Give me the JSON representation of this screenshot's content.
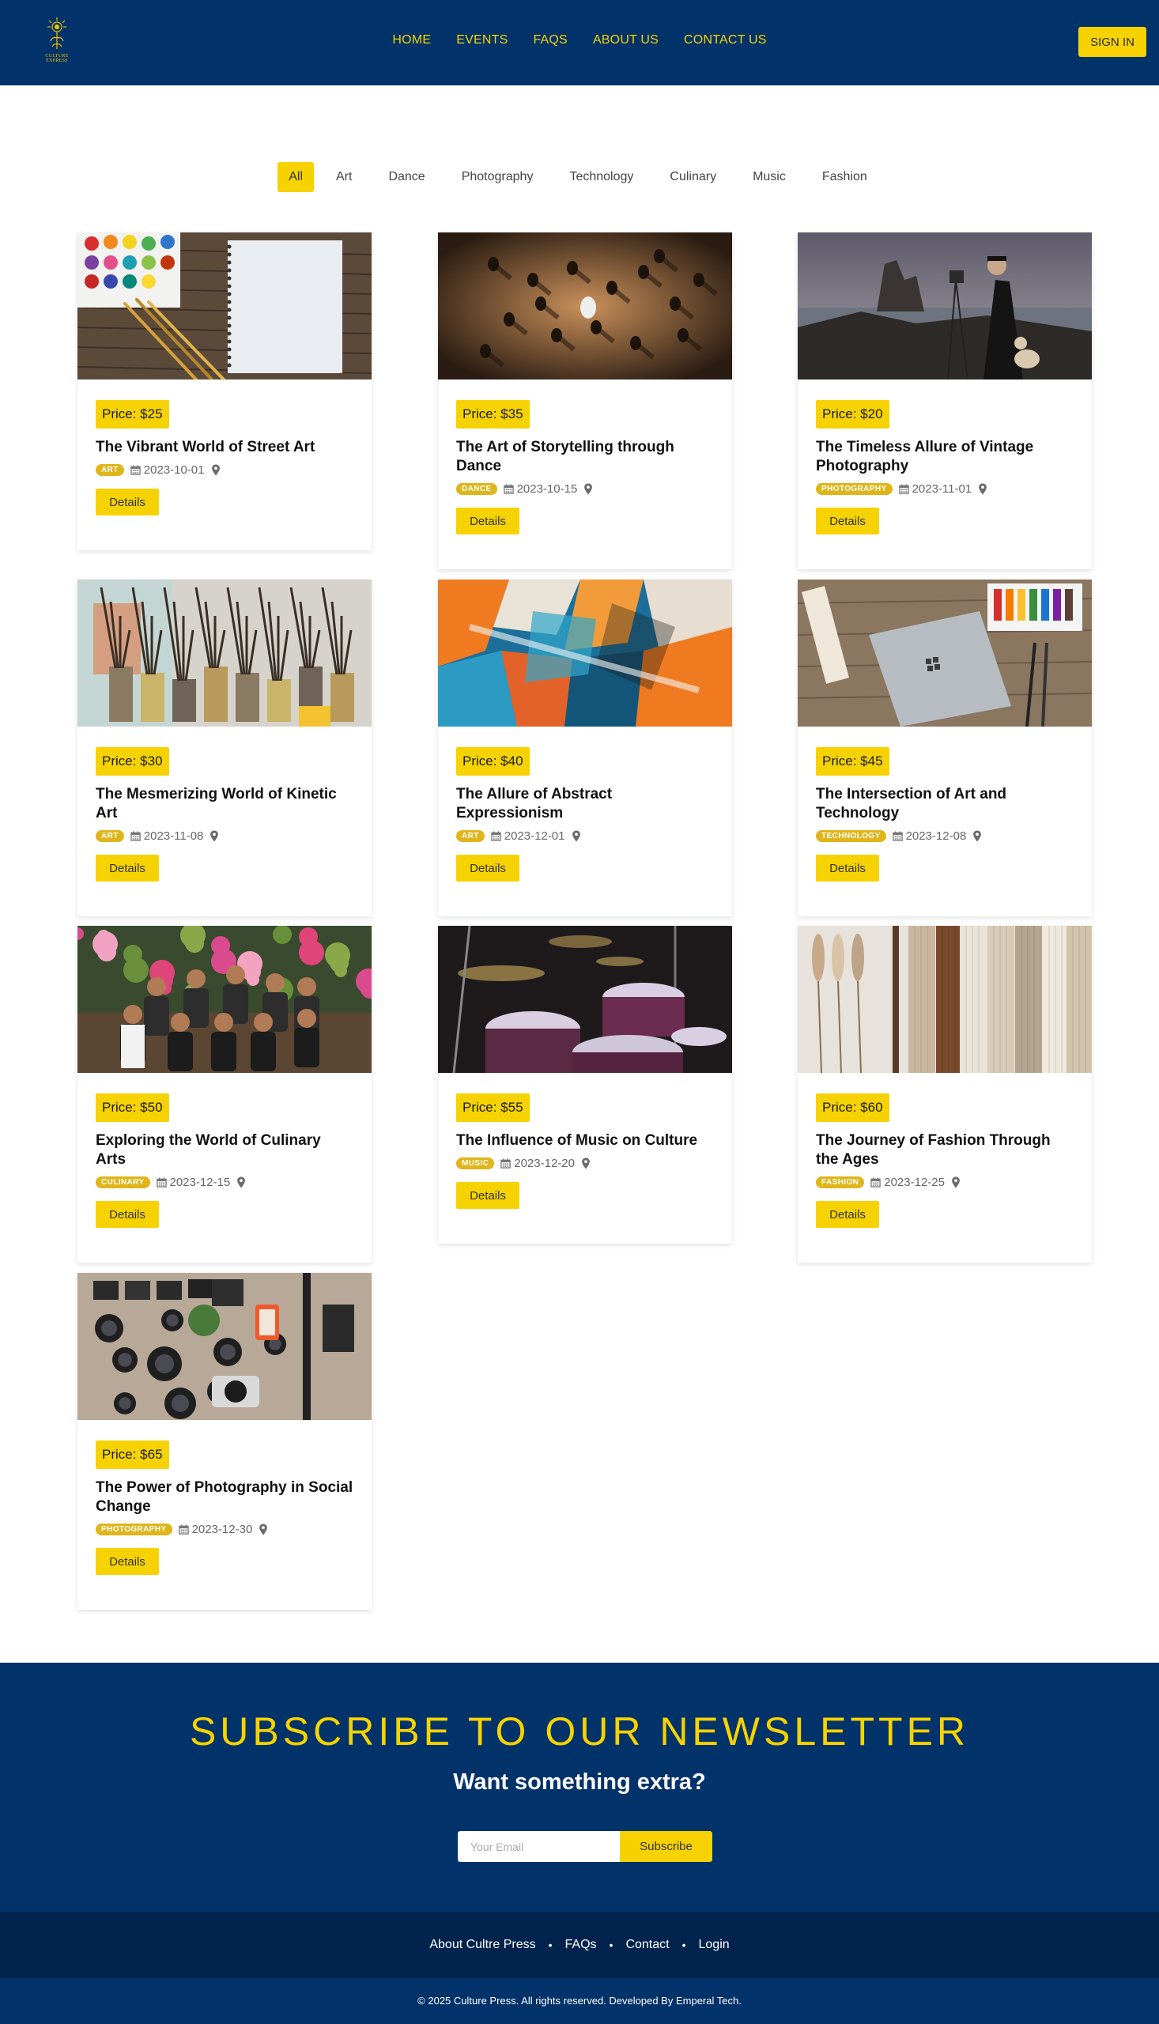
{
  "header": {
    "logo_text": "CULTURE EXPRESS",
    "nav": [
      "HOME",
      "EVENTS",
      "FAQS",
      "ABOUT US",
      "CONTACT US"
    ],
    "signin_label": "SIGN IN"
  },
  "filters": {
    "items": [
      "All",
      "Art",
      "Dance",
      "Photography",
      "Technology",
      "Culinary",
      "Music",
      "Fashion"
    ],
    "active": "All"
  },
  "events": [
    {
      "price": "Price: $25",
      "title": "The Vibrant World of Street Art",
      "tag": "ART",
      "date": "2023-10-01",
      "details": "Details",
      "image": "paint-palette-and-sketchbook"
    },
    {
      "price": "Price: $35",
      "title": "The Art of Storytelling through Dance",
      "tag": "DANCE",
      "date": "2023-10-15",
      "details": "Details",
      "image": "dancers-from-above"
    },
    {
      "price": "Price: $20",
      "title": "The Timeless Allure of Vintage Photography",
      "tag": "PHOTOGRAPHY",
      "date": "2023-11-01",
      "details": "Details",
      "image": "photographer-on-rocky-coast"
    },
    {
      "price": "Price: $30",
      "title": "The Mesmerizing World of Kinetic Art",
      "tag": "ART",
      "date": "2023-11-08",
      "details": "Details",
      "image": "paint-brushes-in-jars"
    },
    {
      "price": "Price: $40",
      "title": "The Allure of Abstract Expressionism",
      "tag": "ART",
      "date": "2023-12-01",
      "details": "Details",
      "image": "abstract-painting"
    },
    {
      "price": "Price: $45",
      "title": "The Intersection of Art and Technology",
      "tag": "TECHNOLOGY",
      "date": "2023-12-08",
      "details": "Details",
      "image": "laptop-and-paints"
    },
    {
      "price": "Price: $50",
      "title": "Exploring the World of Culinary Arts",
      "tag": "CULINARY",
      "date": "2023-12-15",
      "details": "Details",
      "image": "chefs-group-photo"
    },
    {
      "price": "Price: $55",
      "title": "The Influence of Music on Culture",
      "tag": "MUSIC",
      "date": "2023-12-20",
      "details": "Details",
      "image": "drum-kit"
    },
    {
      "price": "Price: $60",
      "title": "The Journey of Fashion Through the Ages",
      "tag": "FASHION",
      "date": "2023-12-25",
      "details": "Details",
      "image": "knit-garments-on-rack"
    },
    {
      "price": "Price: $65",
      "title": "The Power of Photography in Social Change",
      "tag": "PHOTOGRAPHY",
      "date": "2023-12-30",
      "details": "Details",
      "image": "camera-gear-flatlay"
    }
  ],
  "newsletter": {
    "heading": "SUBSCRIBE TO OUR NEWSLETTER",
    "subheading": "Want something extra?",
    "email_placeholder": "Your Email",
    "subscribe_label": "Subscribe"
  },
  "footer": {
    "links": [
      "About Cultre Press",
      "FAQs",
      "Contact",
      "Login"
    ],
    "copyright": "© 2025 Culture Press. All rights reserved. Developed By Emperal Tech."
  },
  "colors": {
    "navy": "#02326a",
    "footer_navy": "#01234d",
    "accent_yellow": "#f6d300",
    "tag_gold": "#e0b51a"
  }
}
